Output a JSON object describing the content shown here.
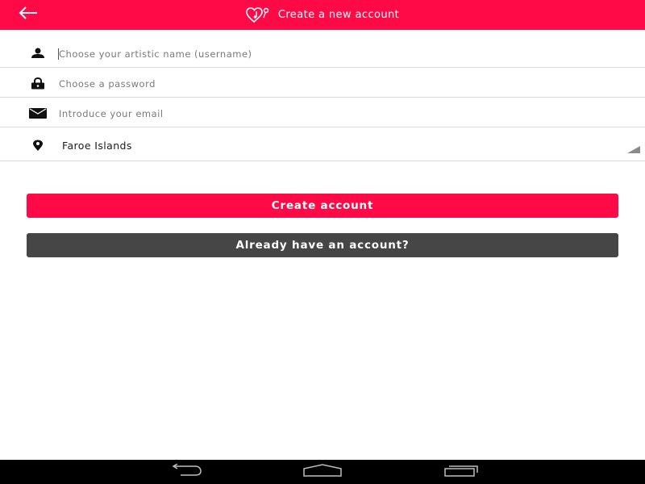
{
  "header": {
    "title": "Create a new account",
    "back_icon": "arrow-left-icon",
    "logo_icon": "heart-music-note-icon",
    "background_color": "#ff0a47"
  },
  "form": {
    "username": {
      "icon": "person-icon",
      "value": "",
      "placeholder": "Choose your artistic name (username)"
    },
    "password": {
      "icon": "lock-icon",
      "value": "",
      "placeholder": "Choose a password"
    },
    "email": {
      "icon": "envelope-icon",
      "value": "",
      "placeholder": "Introduce your email"
    },
    "country": {
      "icon": "location-pin-icon",
      "selected": "Faroe Islands"
    }
  },
  "buttons": {
    "create_account": "Create account",
    "already_have_account": "Already have an account?",
    "primary_color": "#ff0a47",
    "secondary_color": "#464646"
  },
  "navbar": {
    "back_icon": "nav-back-icon",
    "home_icon": "nav-home-icon",
    "recents_icon": "nav-recents-icon"
  }
}
